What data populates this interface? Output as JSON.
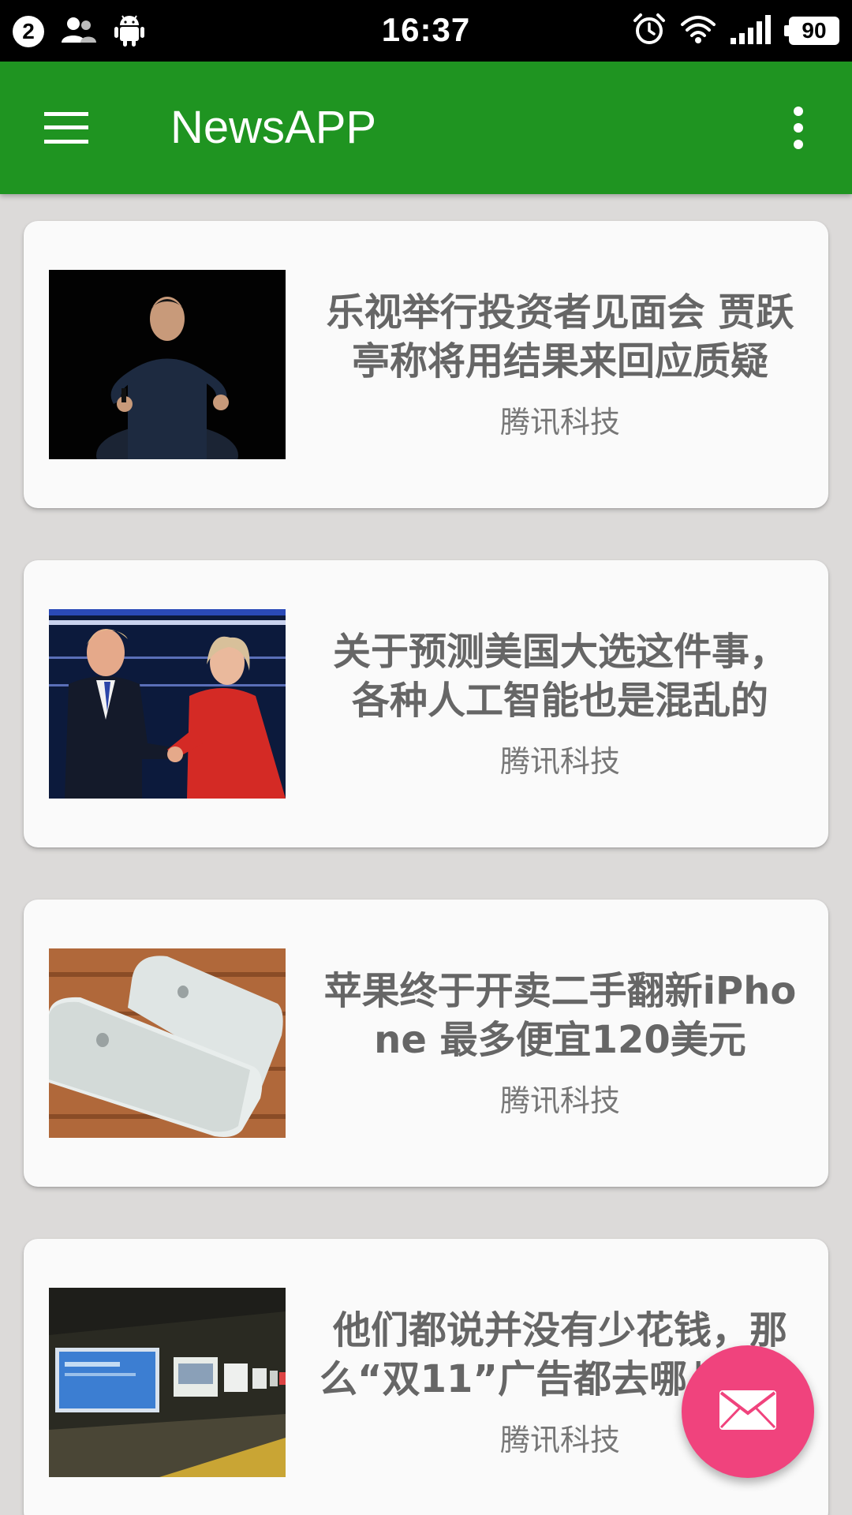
{
  "status_bar": {
    "notification_count": "2",
    "time": "16:37",
    "battery": "90",
    "icons": [
      "contacts-icon",
      "android-icon",
      "alarm-icon",
      "wifi-icon",
      "signal-icon",
      "battery-icon"
    ]
  },
  "appbar": {
    "title": "NewsAPP",
    "menu_icon": "hamburger-menu-icon",
    "overflow_icon": "more-vert-icon",
    "color": "#1f9421"
  },
  "news": [
    {
      "title": "乐视举行投资者见面会 贾跃亭称将用结果来回应质疑",
      "source": "腾讯科技",
      "image": "speaker-on-stage-photo"
    },
    {
      "title": "关于预测美国大选这件事，各种人工智能也是混乱的",
      "source": "腾讯科技",
      "image": "candidates-handshake-photo"
    },
    {
      "title": "苹果终于开卖二手翻新iPhone 最多便宜120美元",
      "source": "腾讯科技",
      "image": "iphones-on-table-photo"
    },
    {
      "title": "他们都说并没有少花钱，那么“双11”广告都去哪儿了？",
      "source": "腾讯科技",
      "image": "subway-billboards-photo"
    }
  ],
  "fab": {
    "icon": "mail-icon",
    "color": "#f0437d"
  }
}
